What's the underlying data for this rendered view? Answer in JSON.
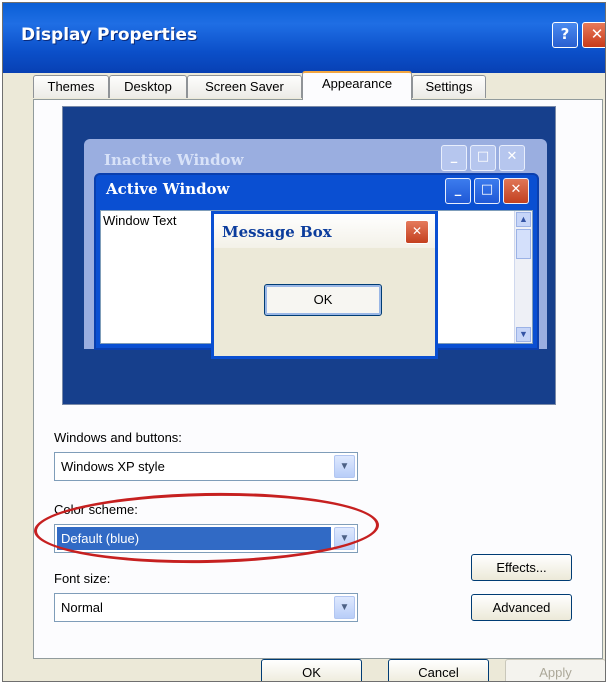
{
  "window": {
    "title": "Display Properties",
    "help_label": "?",
    "close_label": "✕"
  },
  "tabs": [
    {
      "label": "Themes"
    },
    {
      "label": "Desktop"
    },
    {
      "label": "Screen Saver"
    },
    {
      "label": "Appearance",
      "active": true
    },
    {
      "label": "Settings"
    }
  ],
  "preview": {
    "inactive_title": "Inactive Window",
    "active_title": "Active Window",
    "window_text": "Window Text",
    "message_box_title": "Message Box",
    "message_box_ok": "OK"
  },
  "form": {
    "windows_buttons_label": "Windows and buttons:",
    "windows_buttons_value": "Windows XP style",
    "color_scheme_label": "Color scheme:",
    "color_scheme_value": "Default (blue)",
    "font_size_label": "Font size:",
    "font_size_value": "Normal"
  },
  "buttons": {
    "effects": "Effects...",
    "advanced": "Advanced",
    "ok": "OK",
    "cancel": "Cancel",
    "apply": "Apply"
  },
  "colors": {
    "titlebar": "#0b4fc9",
    "annotation_circle": "#c62020",
    "selection": "#316ac5"
  }
}
